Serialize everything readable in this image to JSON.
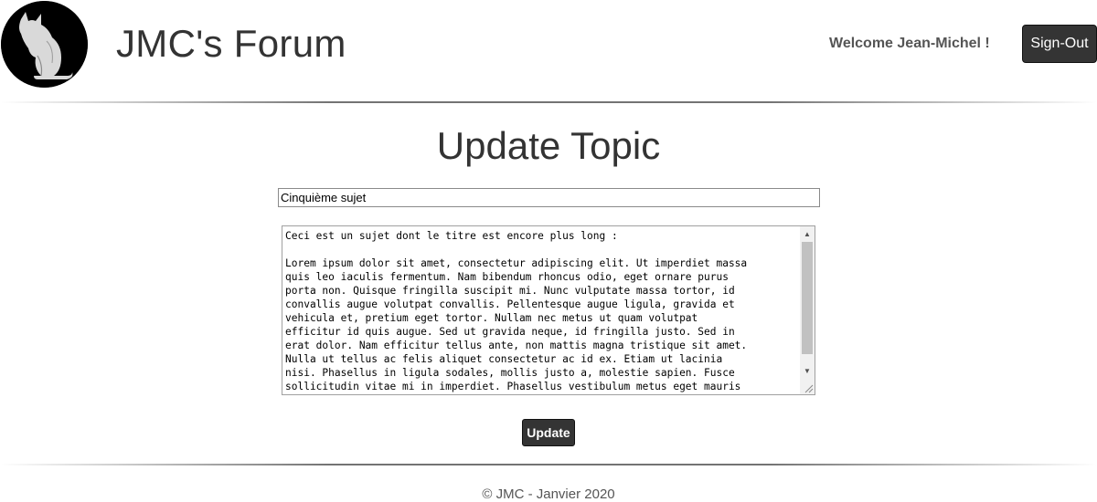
{
  "header": {
    "logo_icon": "cat-silhouette-icon",
    "site_title": "JMC's Forum",
    "welcome_text": "Welcome Jean-Michel !",
    "signout_label": "Sign-Out"
  },
  "main": {
    "page_title": "Update Topic",
    "topic_title_value": "Cinquième sujet",
    "topic_body_value": "Ceci est un sujet dont le titre est encore plus long :\n\nLorem ipsum dolor sit amet, consectetur adipiscing elit. Ut imperdiet massa\nquis leo iaculis fermentum. Nam bibendum rhoncus odio, eget ornare purus\nporta non. Quisque fringilla suscipit mi. Nunc vulputate massa tortor, id\nconvallis augue volutpat convallis. Pellentesque augue ligula, gravida et\nvehicula et, pretium eget tortor. Nullam nec metus ut quam volutpat\nefficitur id quis augue. Sed ut gravida neque, id fringilla justo. Sed in\nerat dolor. Nam efficitur tellus ante, non mattis magna tristique sit amet.\nNulla ut tellus ac felis aliquet consectetur ac id ex. Etiam ut lacinia\nnisi. Phasellus in ligula sodales, mollis justo a, molestie sapien. Fusce\nsollicitudin vitae mi in imperdiet. Phasellus vestibulum metus eget mauris",
    "update_label": "Update"
  },
  "footer": {
    "text": "© JMC - Janvier 2020"
  },
  "colors": {
    "button_bg": "#343434",
    "text": "#333333"
  }
}
